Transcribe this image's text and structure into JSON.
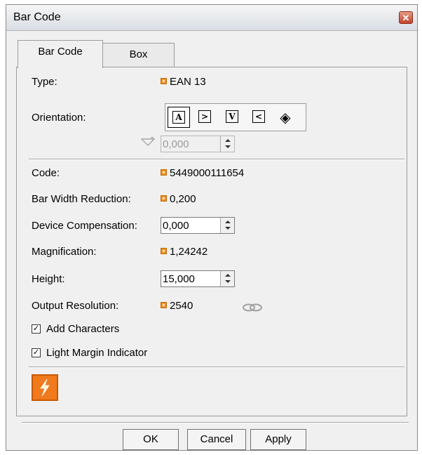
{
  "window": {
    "title": "Bar Code",
    "close_glyph": "✕"
  },
  "tabs": [
    {
      "label": "Bar Code",
      "active": true
    },
    {
      "label": "Box",
      "active": false
    }
  ],
  "type": {
    "label": "Type:",
    "value": "EAN 13"
  },
  "orientation": {
    "label": "Orientation:",
    "buttons": [
      {
        "icon": "orientation-0-icon",
        "glyph": "A",
        "selected": true
      },
      {
        "icon": "orientation-90-icon",
        "glyph": ">",
        "selected": false
      },
      {
        "icon": "orientation-180-icon",
        "glyph": "V",
        "selected": false
      },
      {
        "icon": "orientation-270-icon",
        "glyph": "<",
        "selected": false
      },
      {
        "icon": "orientation-free-icon",
        "glyph": "◈",
        "selected": false
      }
    ],
    "angle_value": "0,000"
  },
  "code": {
    "label": "Code:",
    "value": "5449000111654"
  },
  "bar_width_reduction": {
    "label": "Bar Width Reduction:",
    "value": "0,200"
  },
  "device_compensation": {
    "label": "Device Compensation:",
    "value": "0,000"
  },
  "magnification": {
    "label": "Magnification:",
    "value": "1,24242"
  },
  "height": {
    "label": "Height:",
    "value": "15,000"
  },
  "output_resolution": {
    "label": "Output Resolution:",
    "value": "2540"
  },
  "add_characters": {
    "label": "Add Characters",
    "checked": true
  },
  "light_margin": {
    "label": "Light Margin Indicator",
    "checked": true
  },
  "check_glyph": "✓",
  "buttons": {
    "ok": "OK",
    "cancel": "Cancel",
    "apply": "Apply"
  },
  "colors": {
    "lock_orange": "#f0901c",
    "bolt_orange": "#f07a1c"
  }
}
